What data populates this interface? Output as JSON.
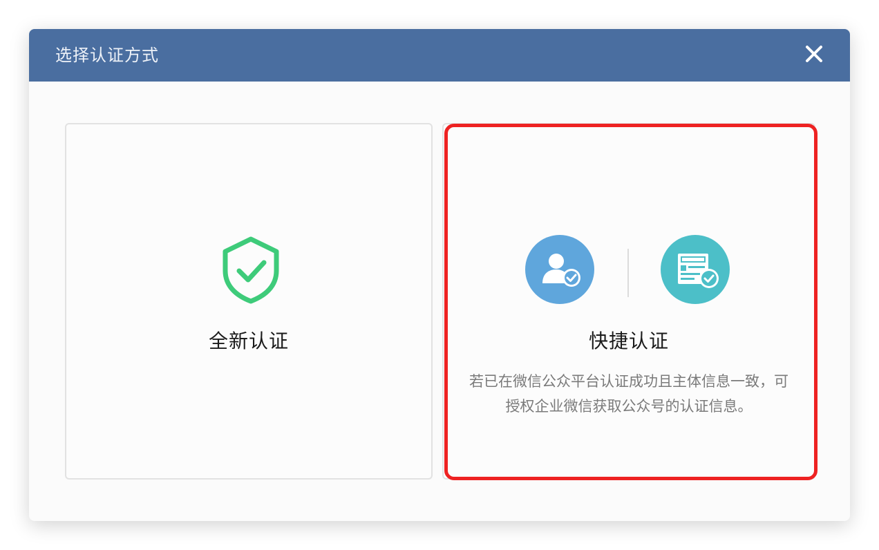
{
  "dialog": {
    "title": "选择认证方式",
    "close_icon": "close-icon"
  },
  "options": {
    "new_auth": {
      "title": "全新认证",
      "icon": "shield-check-icon",
      "icon_color": "#3ecb7a"
    },
    "quick_auth": {
      "title": "快捷认证",
      "icons": [
        "user-verify-icon",
        "document-verify-icon"
      ],
      "description_line1": "若已在微信公众平台认证成功且主体信息一致，可",
      "description_line2": "授权企业微信获取公众号的认证信息。"
    }
  },
  "colors": {
    "header": "#4a6ea0",
    "highlight": "#ee2222",
    "user_icon_bg": "#5fa6dc",
    "doc_icon_bg": "#4cbfc8"
  }
}
